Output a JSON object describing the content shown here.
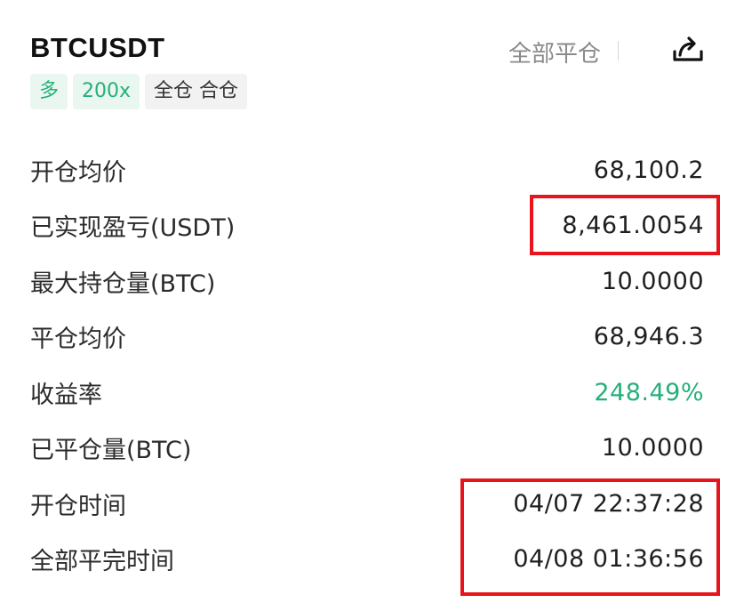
{
  "header": {
    "symbol": "BTCUSDT",
    "close_all_label": "全部平仓",
    "share_icon": "share-icon"
  },
  "tags": [
    {
      "label": "多"
    },
    {
      "label": "200x"
    },
    {
      "label": "全仓 合仓"
    }
  ],
  "details": [
    {
      "label": "开仓均价",
      "value": "68,100.2"
    },
    {
      "label": "已实现盈亏(USDT)",
      "value": "8,461.0054"
    },
    {
      "label": "最大持仓量(BTC)",
      "value": "10.0000"
    },
    {
      "label": "平仓均价",
      "value": "68,946.3"
    },
    {
      "label": "收益率",
      "value": "248.49%"
    },
    {
      "label": "已平仓量(BTC)",
      "value": "10.0000"
    },
    {
      "label": "开仓时间",
      "value": "04/07 22:37:28"
    },
    {
      "label": "全部平完时间",
      "value": "04/08 01:36:56"
    }
  ],
  "colors": {
    "positive": "#25b07a",
    "highlight_box": "#e8141b",
    "muted_text": "#8a8a8a"
  }
}
